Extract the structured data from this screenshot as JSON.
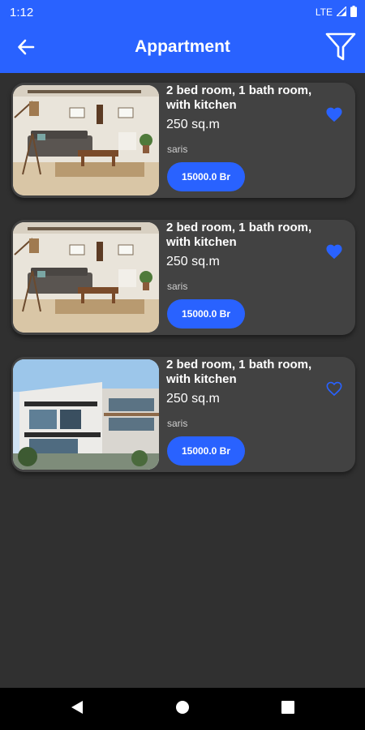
{
  "status_bar": {
    "time": "1:12",
    "network": "LTE",
    "icons": [
      "signal-icon",
      "battery-icon"
    ]
  },
  "app_bar": {
    "title": "Appartment",
    "back_icon": "arrow-left-icon",
    "filter_icon": "filter-icon"
  },
  "colors": {
    "accent": "#2962ff",
    "background": "#303030",
    "card": "#424242"
  },
  "listings": [
    {
      "title": "2 bed room, 1 bath room, with kitchen",
      "area": "250 sq.m",
      "owner": "saris",
      "price": "15000.0 Br",
      "favorite": true,
      "image": "living-room"
    },
    {
      "title": "2 bed room, 1 bath room, with kitchen",
      "area": "250 sq.m",
      "owner": "saris",
      "price": "15000.0 Br",
      "favorite": true,
      "image": "living-room"
    },
    {
      "title": "2 bed room, 1 bath room, with kitchen",
      "area": "250 sq.m",
      "owner": "saris",
      "price": "15000.0 Br",
      "favorite": false,
      "image": "building-exterior"
    }
  ],
  "nav_bar": {
    "icons": [
      "back-triangle-icon",
      "home-circle-icon",
      "recents-square-icon"
    ]
  }
}
